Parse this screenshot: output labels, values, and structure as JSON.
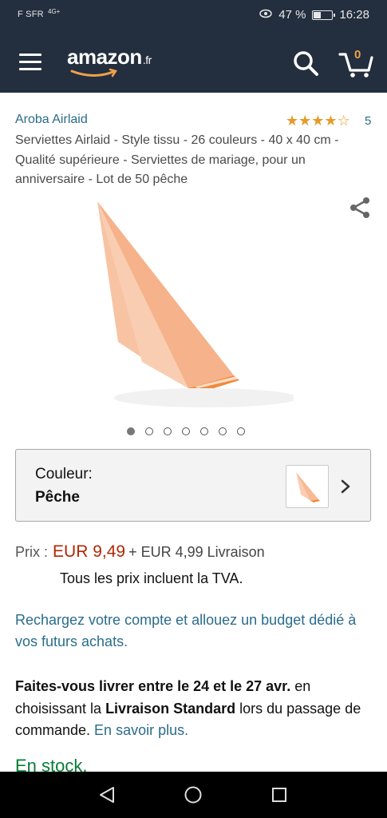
{
  "status_bar": {
    "carrier": "F SFR",
    "network": "4G+",
    "battery_percent": "47 %",
    "battery_level": 0.47,
    "time": "16:28"
  },
  "header": {
    "logo_text": "amazon",
    "logo_suffix": ".fr",
    "cart_count": "0"
  },
  "product": {
    "brand": "Aroba Airlaid",
    "rating_stars": 4.5,
    "rating_count": "5",
    "title": "Serviettes Airlaid - Style tissu - 26 couleurs - 40 x 40 cm - Qualité supérieure - Serviettes de mariage, pour un anniversaire - Lot de 50 pêche",
    "image_count": 7,
    "active_image_index": 0
  },
  "color_selector": {
    "label": "Couleur:",
    "value": "Pêche"
  },
  "pricing": {
    "price_label": "Prix :",
    "price": "EUR 9,49",
    "shipping": "+ EUR 4,99 Livraison",
    "tax_note": "Tous les prix incluent la TVA."
  },
  "promo_link": "Rechargez votre compte et allouez un budget dédié à vos futurs achats.",
  "delivery": {
    "part1": "Faites-vous livrer entre le 24 et le 27 avr.",
    "part2": " en choisissant la ",
    "part3": "Livraison Standard",
    "part4": " lors du passage de commande. ",
    "link": "En savoir plus."
  },
  "stock_status": "En stock.",
  "colors": {
    "nav_bg": "#232f3e",
    "link": "#2a6c8b",
    "price": "#b12704",
    "star": "#e69a28",
    "stock": "#067d36",
    "napkin": "#f6b48a"
  }
}
